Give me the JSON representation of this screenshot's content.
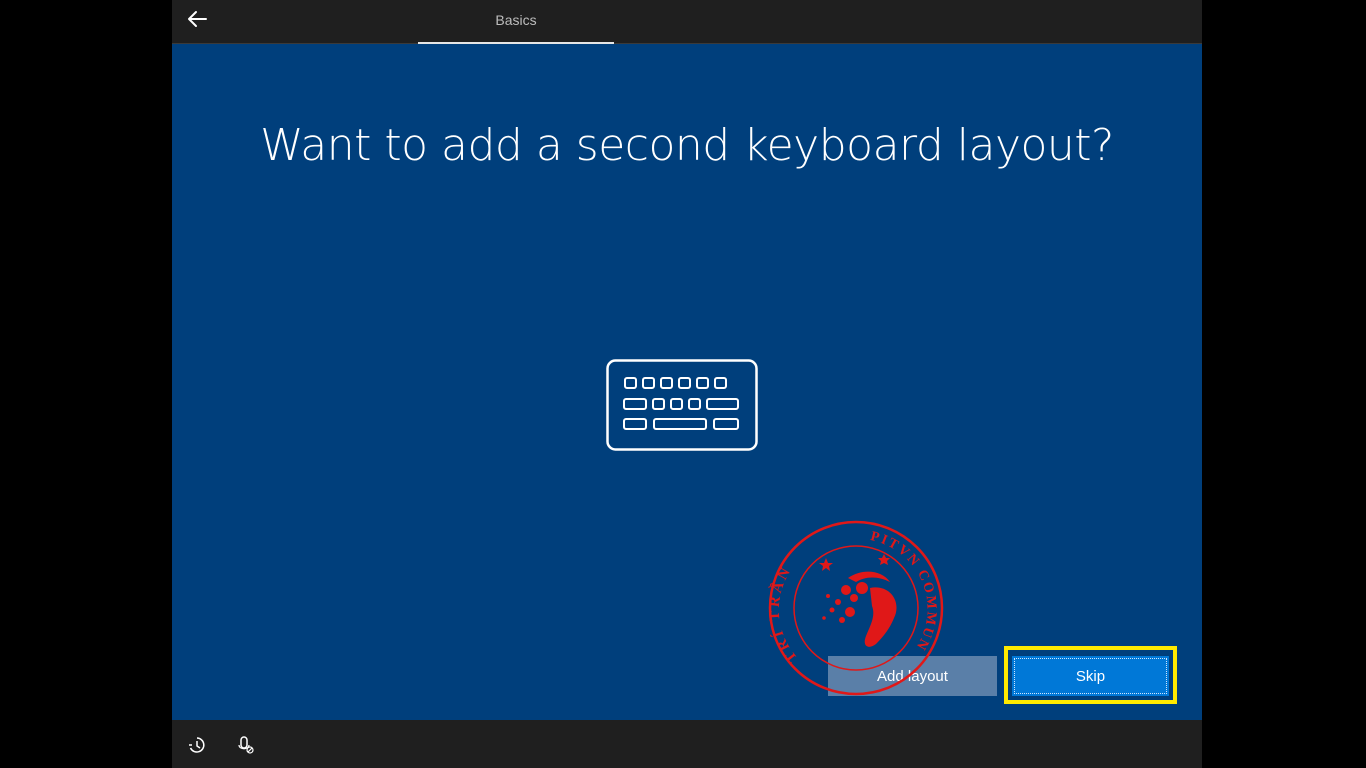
{
  "header": {
    "back_icon": "arrow-left-icon",
    "tab_label": "Basics"
  },
  "main": {
    "title": "Want to add a second keyboard layout?",
    "illustration_icon": "keyboard-icon"
  },
  "buttons": {
    "add_layout": "Add layout",
    "skip": "Skip"
  },
  "watermark": {
    "text_left": "TRÍ TRẦN",
    "text_right": "PITVN COMMUNITY",
    "color": "#e01818"
  },
  "footer": {
    "icons": [
      "ease-of-access-icon",
      "microphone-icon"
    ]
  },
  "colors": {
    "background": "#003f7c",
    "bars": "#1f1f1f",
    "accent": "#0078d7",
    "highlight": "#ffea00"
  }
}
